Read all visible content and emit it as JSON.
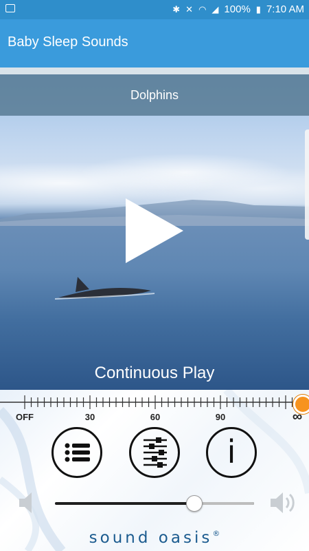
{
  "status_bar": {
    "battery": "100%",
    "time": "7:10 AM",
    "icons": [
      "notification-icon",
      "bluetooth-icon",
      "mute-icon",
      "wifi-icon",
      "signal-icon",
      "battery-icon"
    ]
  },
  "app_bar": {
    "title": "Baby Sleep Sounds"
  },
  "sound": {
    "name": "Dolphins"
  },
  "timer": {
    "mode": "Continuous Play",
    "labels": [
      "OFF",
      "30",
      "60",
      "90",
      "∞"
    ],
    "selected": "∞",
    "accent_color": "#f7931e"
  },
  "controls": {
    "buttons": [
      "list-icon",
      "mixer-icon",
      "info-icon"
    ],
    "info_label": "i"
  },
  "volume": {
    "level": 0.7
  },
  "brand": {
    "text": "sound oasis",
    "reg": "®"
  }
}
